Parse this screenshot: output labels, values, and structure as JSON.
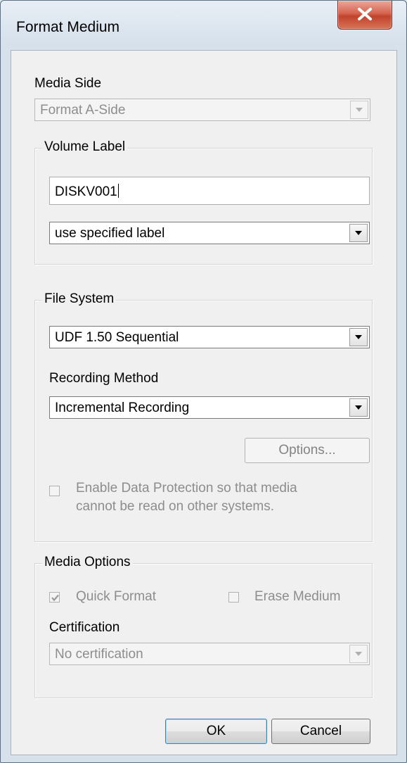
{
  "window": {
    "title": "Format Medium"
  },
  "media_side": {
    "label": "Media Side",
    "selected": "Format A-Side"
  },
  "volume_label": {
    "group_title": "Volume Label",
    "value": "DISKV001",
    "mode_selected": "use specified label"
  },
  "file_system": {
    "group_title": "File System",
    "selected": "UDF 1.50 Sequential",
    "recording_method_label": "Recording Method",
    "recording_method_selected": "Incremental Recording",
    "options_label": "Options...",
    "protection_line1": "Enable Data Protection so that media",
    "protection_line2": "cannot be read on other systems."
  },
  "media_options": {
    "group_title": "Media Options",
    "quick_format": "Quick Format",
    "erase_medium": "Erase Medium",
    "certification_label": "Certification",
    "certification_selected": "No certification"
  },
  "buttons": {
    "ok": "OK",
    "cancel": "Cancel"
  },
  "icons": {
    "close": "close-icon",
    "dropdown": "chevron-down-icon",
    "check": "check-icon"
  }
}
